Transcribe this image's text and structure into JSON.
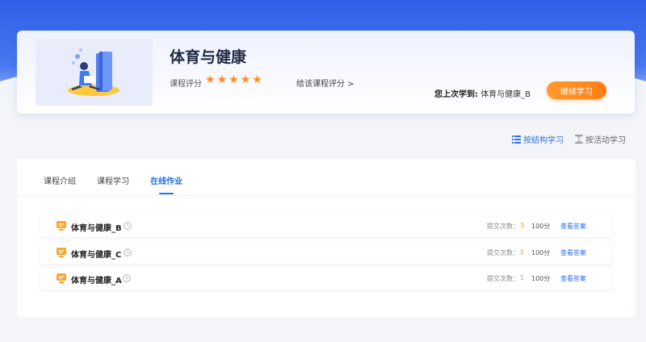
{
  "course": {
    "title": "体育与健康",
    "rating_label": "课程评分",
    "rating": 5,
    "rating_max": 5,
    "rate_link": "给该课程评分 >",
    "last_study_label": "您上次学到:",
    "last_study_value": "体育与健康_B",
    "continue_button": "继续学习"
  },
  "modes": [
    {
      "label": "按结构学习",
      "icon": "list-icon",
      "active": true
    },
    {
      "label": "按活动学习",
      "icon": "hourglass-icon",
      "active": false
    }
  ],
  "tabs": [
    {
      "label": "课程介绍",
      "active": false
    },
    {
      "label": "课程学习",
      "active": false
    },
    {
      "label": "在线作业",
      "active": true
    }
  ],
  "homework": [
    {
      "title": "体育与健康_B",
      "submit_label": "提交次数：",
      "submit_count": "3",
      "score": "100分",
      "action": "查看答案"
    },
    {
      "title": "体育与健康_C",
      "submit_label": "提交次数：",
      "submit_count": "1",
      "score": "100分",
      "action": "查看答案"
    },
    {
      "title": "体育与健康_A",
      "submit_label": "提交次数：",
      "submit_count": "1",
      "score": "100分",
      "action": "查看答案"
    }
  ],
  "colors": {
    "primary": "#1f6fe6",
    "accent_orange": "#ff8a1f",
    "hero_blue": "#2f5fe6"
  }
}
